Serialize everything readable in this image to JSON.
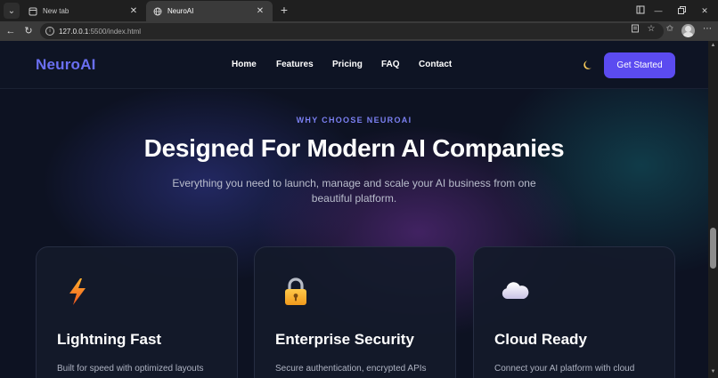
{
  "browser": {
    "tabs": [
      {
        "label": "New tab",
        "icon": "page-icon",
        "active": false
      },
      {
        "label": "NeuroAI",
        "icon": "globe-icon",
        "active": true
      }
    ],
    "url_host": "127.0.0.1",
    "url_rest": ":5500/index.html"
  },
  "site": {
    "logo": "NeuroAI",
    "nav": [
      "Home",
      "Features",
      "Pricing",
      "FAQ",
      "Contact"
    ],
    "cta": "Get Started",
    "theme_icon": "moon-icon"
  },
  "hero": {
    "eyebrow": "WHY CHOOSE NEUROAI",
    "title": "Designed For Modern AI Companies",
    "subtitle": "Everything you need to launch, manage and scale your AI business from one beautiful platform."
  },
  "features": [
    {
      "icon": "lightning-icon",
      "title": "Lightning Fast",
      "desc": "Built for speed with optimized layouts"
    },
    {
      "icon": "lock-icon",
      "title": "Enterprise Security",
      "desc": "Secure authentication, encrypted APIs"
    },
    {
      "icon": "cloud-icon",
      "title": "Cloud Ready",
      "desc": "Connect your AI platform with cloud"
    }
  ],
  "colors": {
    "brand": "#6a6ff2",
    "cta_bg": "#5b4bf0",
    "page_bg": "#0d1222"
  }
}
